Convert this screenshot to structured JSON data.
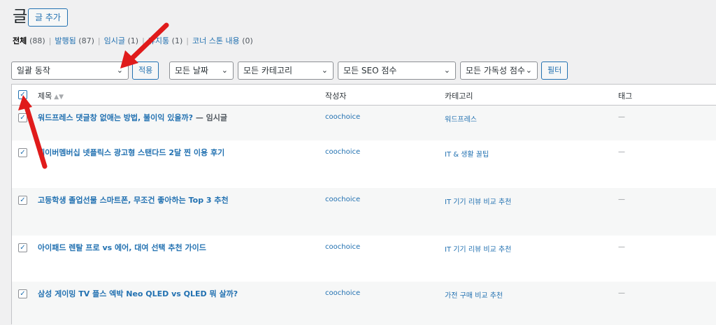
{
  "header": {
    "title": "글",
    "add_label": "글 추가"
  },
  "filters_nav": {
    "items": [
      {
        "label": "전체",
        "count": "(88)",
        "current": true
      },
      {
        "label": "발행됨",
        "count": "(87)"
      },
      {
        "label": "임시글",
        "count": "(1)"
      },
      {
        "label": "휴지통",
        "count": "(1)"
      },
      {
        "label": "코너 스톤 내용",
        "count": "(0)"
      }
    ]
  },
  "toolbar": {
    "bulk_action": "일괄 동작",
    "apply_label": "적용",
    "date_filter": "모든 날짜",
    "category_filter": "모든 카테고리",
    "seo_filter": "모든 SEO 점수",
    "readability_filter": "모든 가독성 점수",
    "filter_label": "필터",
    "chevron": "⌄"
  },
  "table": {
    "columns": {
      "title": "제목",
      "author": "작성자",
      "category": "카테고리",
      "tags": "태그"
    },
    "sort_glyph": "▲▼",
    "check_glyph": "✓",
    "rows": [
      {
        "title": "워드프레스 댓글창 없애는 방법, 불이익 있을까?",
        "state": " — 임시글",
        "author": "coochoice",
        "category": "워드프레스",
        "tags": "—"
      },
      {
        "title": "네이버멤버십 넷플릭스 광고형 스탠다드 2달 찐 이용 후기",
        "state": "",
        "author": "coochoice",
        "category": "IT & 생활 꿀팁",
        "tags": "—"
      },
      {
        "title": "고등학생 졸업선물 스마트폰, 무조건 좋아하는 Top 3 추천",
        "state": "",
        "author": "coochoice",
        "category": "IT 기기 리뷰 비교 추천",
        "tags": "—"
      },
      {
        "title": "아이패드 렌탈 프로 vs 에어, 대여 선택 추천 가이드",
        "state": "",
        "author": "coochoice",
        "category": "IT 기기 리뷰 비교 추천",
        "tags": "—"
      },
      {
        "title": "삼성 게이밍 TV 플스 엑박 Neo QLED vs QLED 뭐 살까?",
        "state": "",
        "author": "coochoice",
        "category": "가전 구매 비교 추천",
        "tags": "—"
      }
    ]
  },
  "colors": {
    "accent": "#2271b1",
    "annotation": "#e01b1b"
  }
}
